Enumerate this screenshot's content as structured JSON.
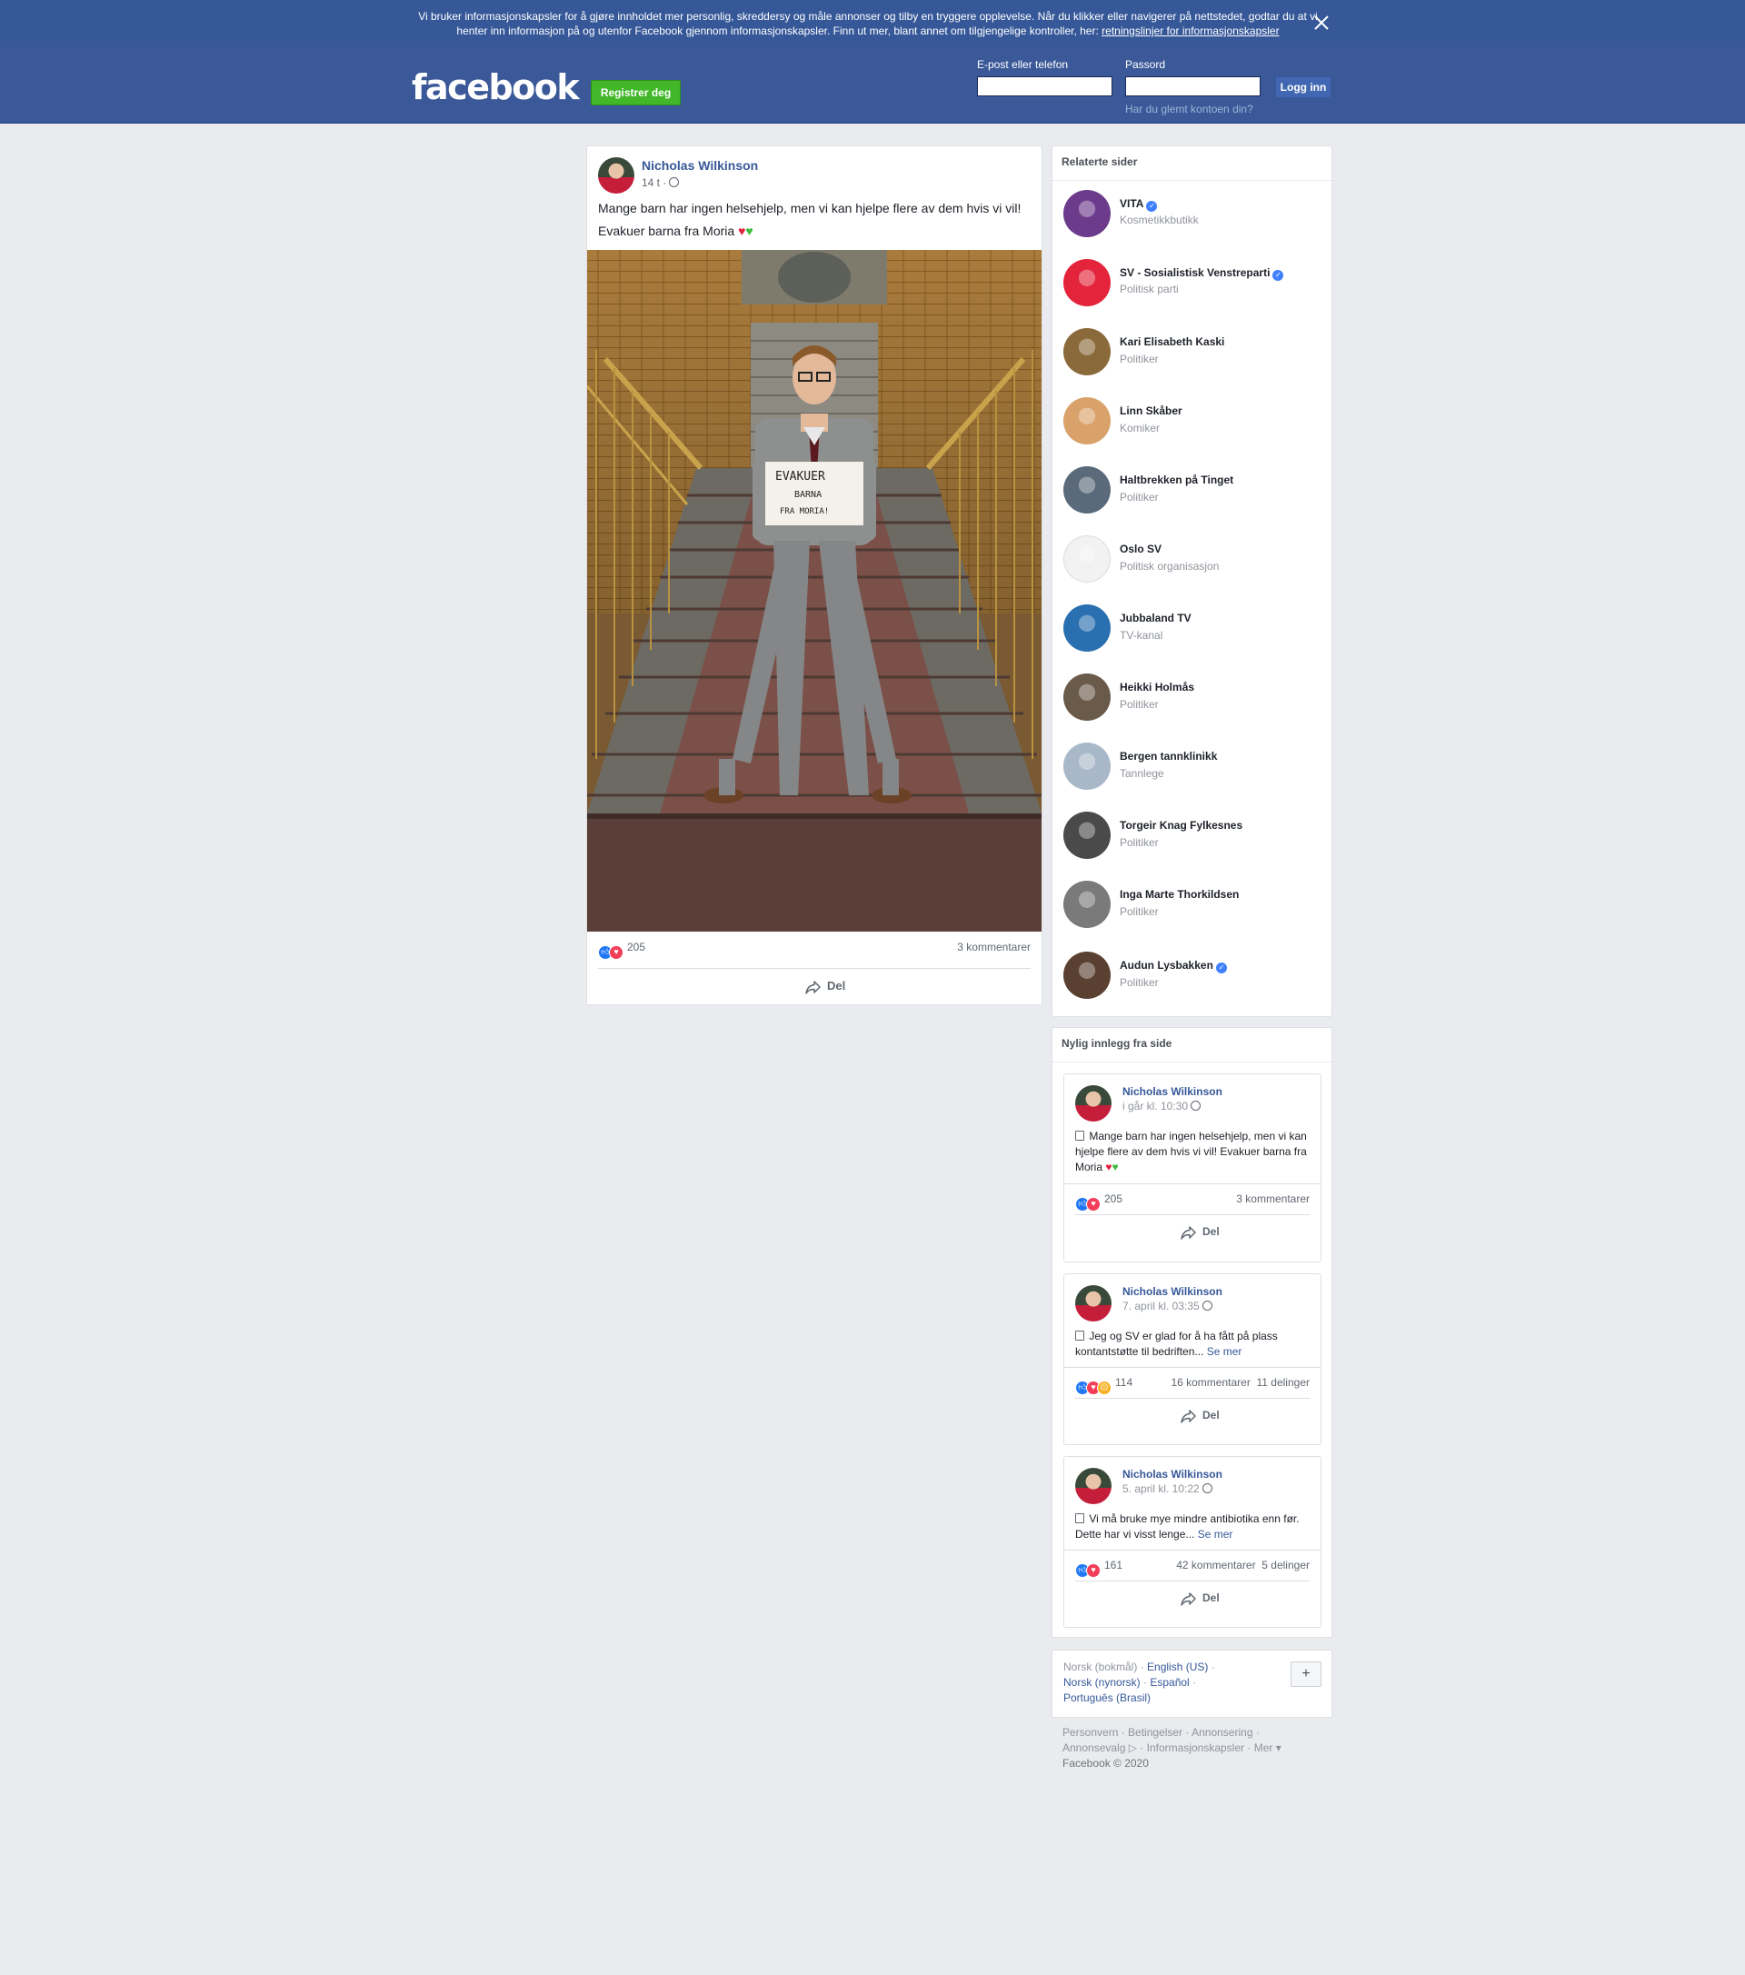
{
  "cookie_banner": {
    "text": "Vi bruker informasjonskapsler for å gjøre innholdet mer personlig, skreddersy og måle annonser og tilby en tryggere opplevelse. Når du klikker eller navigerer på nettstedet, godtar du at vi henter inn informasjon på og utenfor Facebook gjennom informasjonskapsler. Finn ut mer, blant annet om tilgjengelige kontroller, her: ",
    "link": "retningslinjer for informasjonskapsler"
  },
  "header": {
    "logo": "facebook",
    "register": "Registrer deg",
    "email_label": "E-post eller telefon",
    "password_label": "Passord",
    "login": "Logg inn",
    "forgot": "Har du glemt kontoen din?"
  },
  "post": {
    "author": "Nicholas Wilkinson",
    "time": "14 t ·",
    "text_line1": "Mange barn har ingen helsehjelp, men vi kan hjelpe flere av dem hvis vi vil!",
    "text_line2": "Evakuer barna fra Moria",
    "sign_text": [
      "EVAKUER",
      "BARNA",
      "FRA MORIA!"
    ],
    "reactions": "205",
    "comments": "3 kommentarer",
    "share": "Del"
  },
  "related": {
    "title": "Relaterte sider",
    "items": [
      {
        "name": "VITA",
        "sub": "Kosmetikkbutikk",
        "verified": true,
        "color": "#6c3b8c"
      },
      {
        "name": "SV - Sosialistisk Venstreparti",
        "sub": "Politisk parti",
        "verified": true,
        "color": "#e3243b"
      },
      {
        "name": "Kari Elisabeth Kaski",
        "sub": "Politiker",
        "verified": false,
        "color": "#8a6a3a"
      },
      {
        "name": "Linn Skåber",
        "sub": "Komiker",
        "verified": false,
        "color": "#d9a26a"
      },
      {
        "name": "Haltbrekken på Tinget",
        "sub": "Politiker",
        "verified": false,
        "color": "#5a6a7a"
      },
      {
        "name": "Oslo SV",
        "sub": "Politisk organisasjon",
        "verified": false,
        "color": "#f2f2f2"
      },
      {
        "name": "Jubbaland TV",
        "sub": "TV-kanal",
        "verified": false,
        "color": "#2a6fb0"
      },
      {
        "name": "Heikki Holmås",
        "sub": "Politiker",
        "verified": false,
        "color": "#6a5a4a"
      },
      {
        "name": "Bergen tannklinikk",
        "sub": "Tannlege",
        "verified": false,
        "color": "#a8b8c8"
      },
      {
        "name": "Torgeir Knag Fylkesnes",
        "sub": "Politiker",
        "verified": false,
        "color": "#4a4a4a"
      },
      {
        "name": "Inga Marte Thorkildsen",
        "sub": "Politiker",
        "verified": false,
        "color": "#7a7a7a"
      },
      {
        "name": "Audun Lysbakken",
        "sub": "Politiker",
        "verified": true,
        "color": "#5a4030"
      }
    ]
  },
  "recent": {
    "title": "Nylig innlegg fra side",
    "posts": [
      {
        "author": "Nicholas Wilkinson",
        "time": "i går kl. 10:30",
        "text": "Mange barn har ingen helsehjelp, men vi kan hjelpe flere av dem hvis vi vil! Evakuer barna fra Moria",
        "more": "",
        "reactions": "205",
        "comments": "3 kommentarer",
        "shares": "",
        "share": "Del"
      },
      {
        "author": "Nicholas Wilkinson",
        "time": "7. april kl. 03:35",
        "text": "Jeg og SV er glad for å ha fått på plass kontantstøtte til bedriften...",
        "more": "Se mer",
        "reactions": "114",
        "comments": "16 kommentarer",
        "shares": "11 delinger",
        "share": "Del"
      },
      {
        "author": "Nicholas Wilkinson",
        "time": "5. april kl. 10:22",
        "text": "Vi må bruke mye mindre antibiotika enn før. Dette har vi visst lenge...",
        "more": "Se mer",
        "reactions": "161",
        "comments": "42 kommentarer",
        "shares": "5 delinger",
        "share": "Del"
      }
    ]
  },
  "languages": {
    "current": "Norsk (bokmål)",
    "others": [
      "English (US)",
      "Norsk (nynorsk)",
      "Español",
      "Português (Brasil)"
    ],
    "plus": "+"
  },
  "footer": {
    "links": [
      "Personvern",
      "Betingelser",
      "Annonsering",
      "Annonsevalg",
      "Informasjonskapsler",
      "Mer"
    ],
    "copyright": "Facebook © 2020"
  }
}
